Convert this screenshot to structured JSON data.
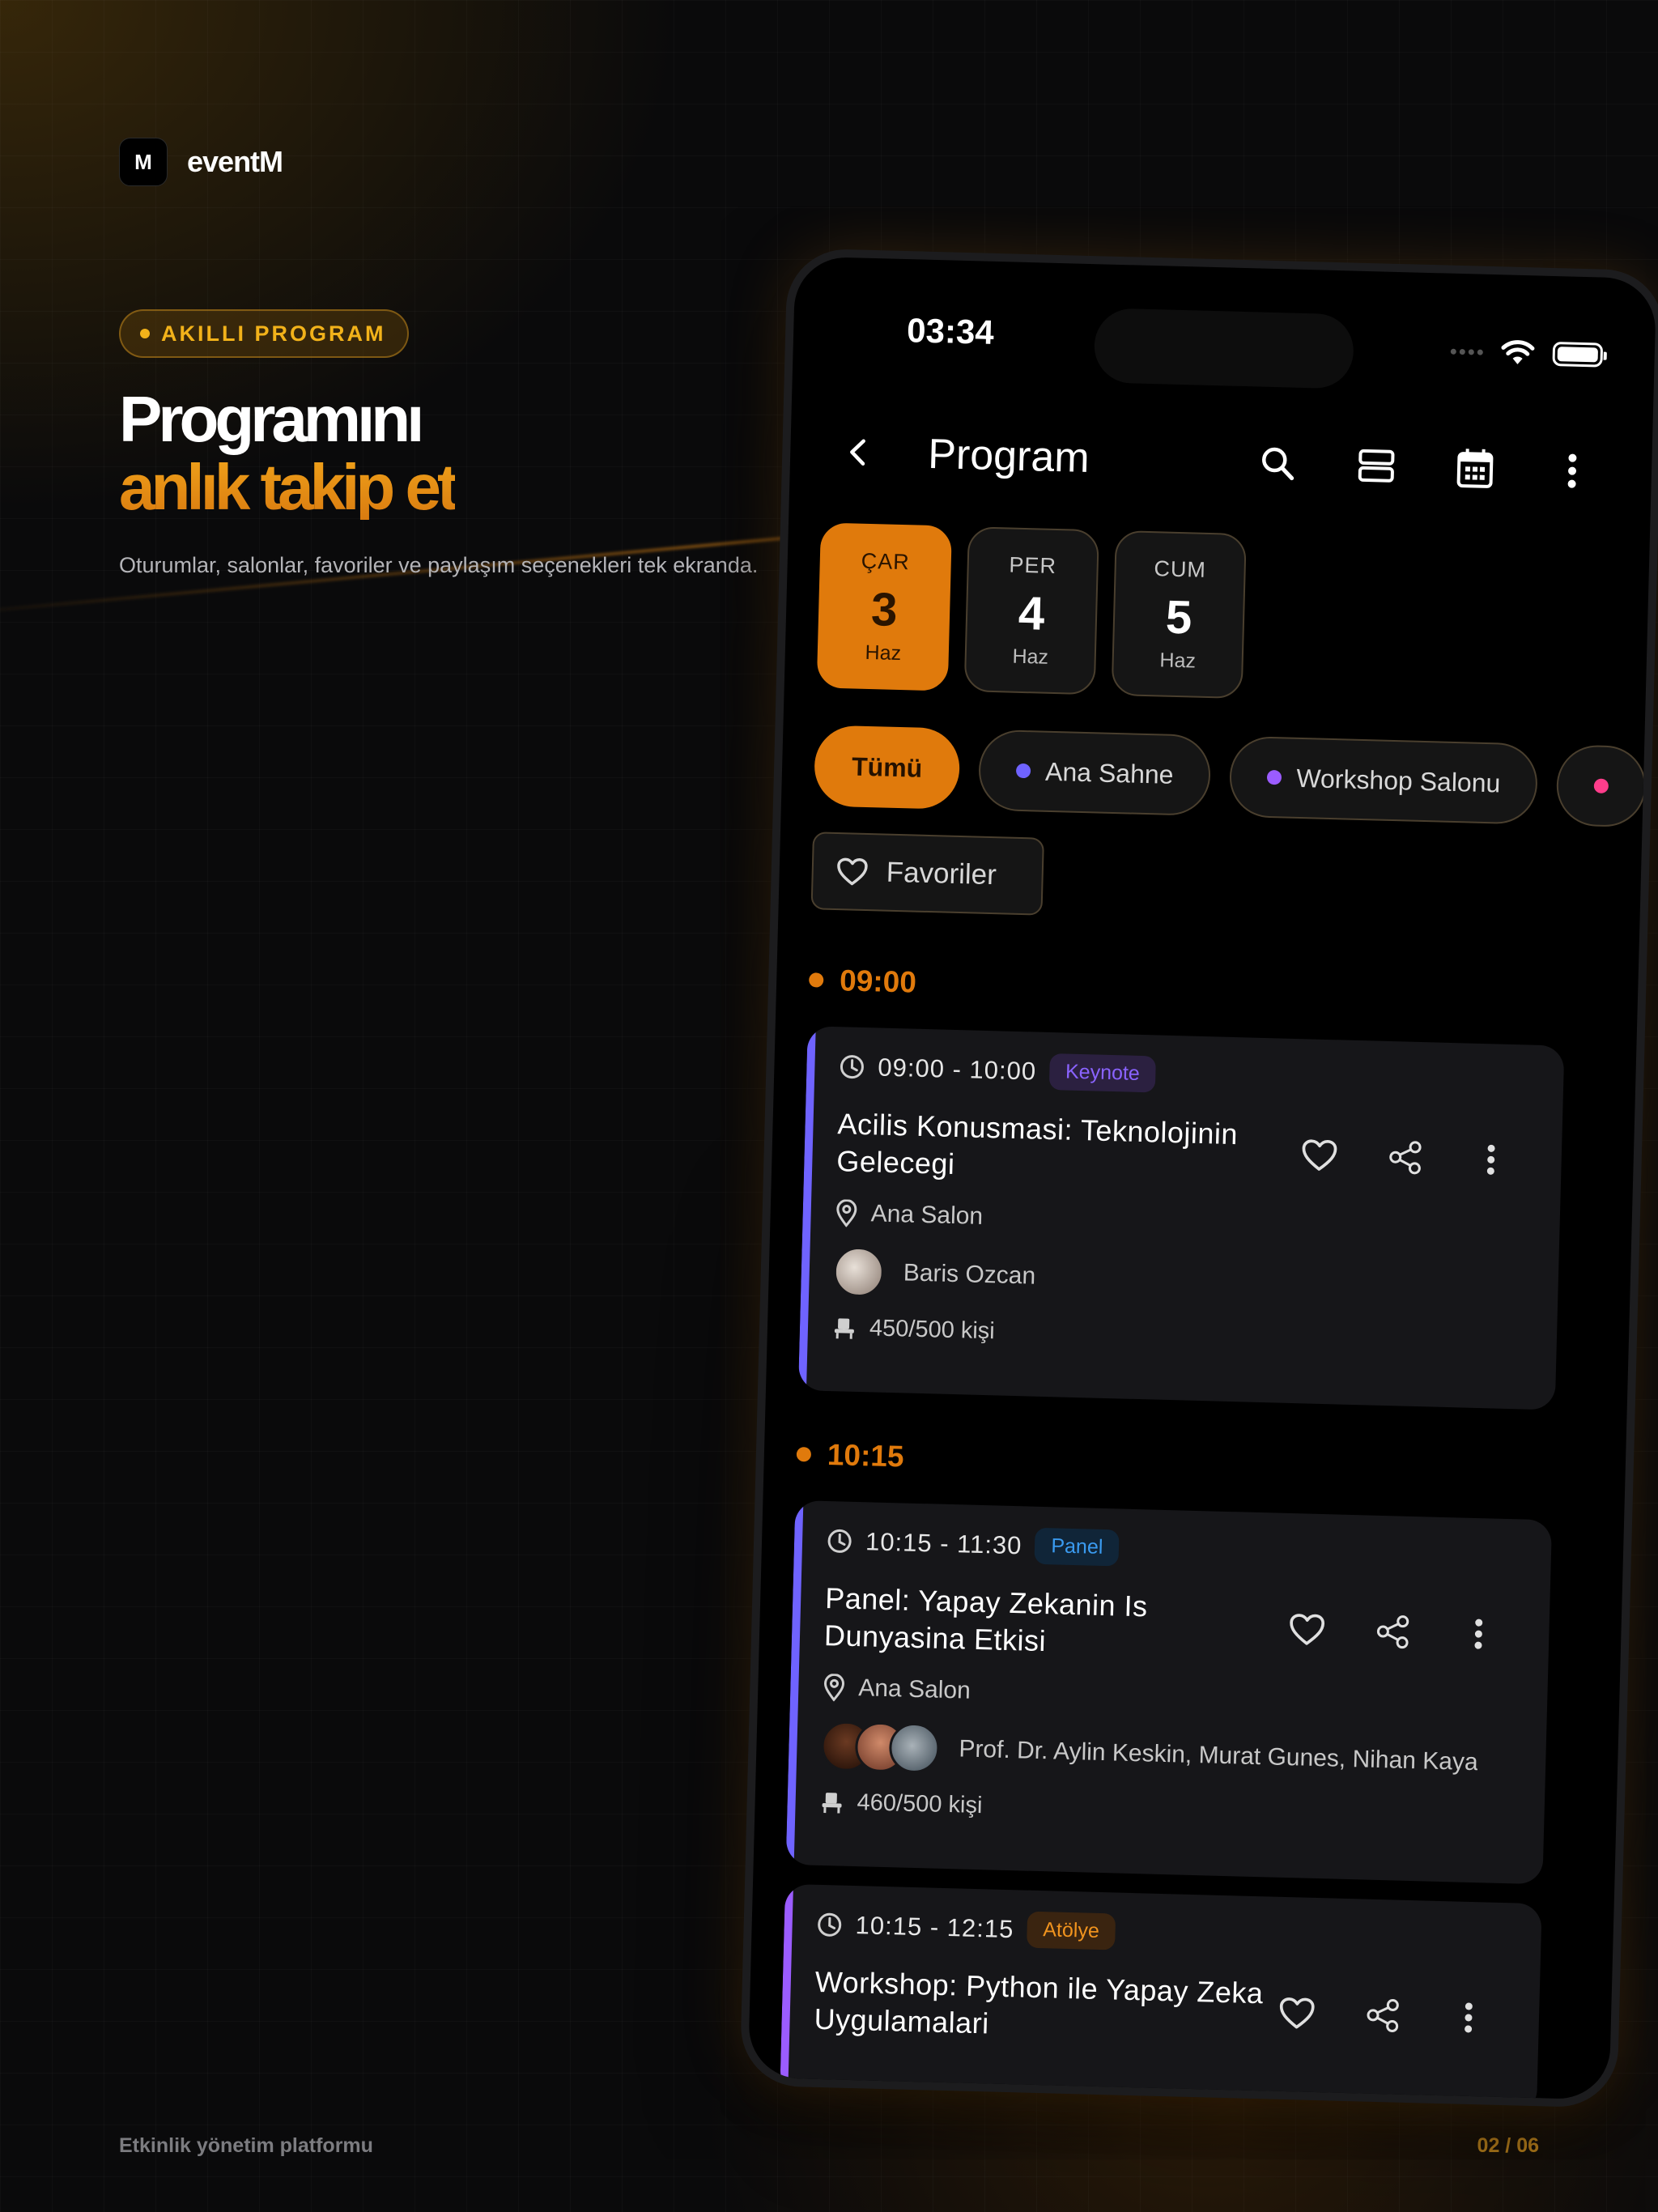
{
  "brand": {
    "logo_letter": "M",
    "name": "eventM"
  },
  "hero": {
    "pill": "AKILLI PROGRAM",
    "title_line1": "Programını",
    "title_line2": "anlık takip et",
    "lead": "Oturumlar, salonlar, favoriler ve paylaşım seçenekleri tek ekranda."
  },
  "footer": {
    "left": "Etkinlik yönetim platformu",
    "right": "02 / 06"
  },
  "status": {
    "time": "03:34"
  },
  "appbar": {
    "title": "Program",
    "icons": [
      "back-icon",
      "search-icon",
      "view-toggle-icon",
      "calendar-icon",
      "more-vert-icon"
    ]
  },
  "days": [
    {
      "weekday": "ÇAR",
      "day": "3",
      "month": "Haz",
      "active": true
    },
    {
      "weekday": "PER",
      "day": "4",
      "month": "Haz",
      "active": false
    },
    {
      "weekday": "CUM",
      "day": "5",
      "month": "Haz",
      "active": false
    }
  ],
  "filters": {
    "chips": [
      {
        "label": "Tümü",
        "active": true
      },
      {
        "label": "Ana Sahne",
        "dot": "#6f63ff"
      },
      {
        "label": "Workshop Salonu",
        "dot": "#9b5cff"
      },
      {
        "label": "",
        "dot": "#ff3d8b"
      }
    ],
    "favorites_label": "Favoriler"
  },
  "colors": {
    "accent": "#e07a0c",
    "keynote_bar": "#6f63ff",
    "workshop_bar": "#9b5cff"
  },
  "schedule": {
    "slot1": {
      "time": "09:00"
    },
    "session1": {
      "time": "09:00 - 10:00",
      "badge": "Keynote",
      "title": "Acilis Konusmasi: Teknolojinin Gelecegi",
      "location": "Ana Salon",
      "speakers": "Baris Ozcan",
      "capacity": "450/500 kişi"
    },
    "slot2": {
      "time": "10:15"
    },
    "session2": {
      "time": "10:15 - 11:30",
      "badge": "Panel",
      "title": "Panel: Yapay Zekanin Is Dunyasina Etkisi",
      "location": "Ana Salon",
      "speakers": "Prof. Dr. Aylin Keskin, Murat Gunes, Nihan Kaya",
      "capacity": "460/500 kişi"
    },
    "session3": {
      "time": "10:15 - 12:15",
      "badge": "Atölye",
      "title": "Workshop: Python ile Yapay Zeka Uygulamalari"
    }
  }
}
